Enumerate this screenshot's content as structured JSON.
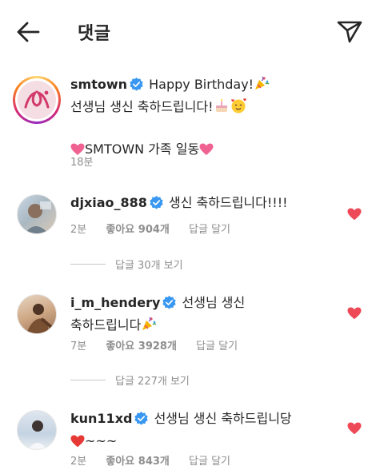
{
  "header": {
    "title": "댓글"
  },
  "caption": {
    "username": "smtown",
    "text_line1": "Happy Birthday!",
    "text_line2": "선생님 생신 축하드립니다!",
    "text_line3": "SMTOWN 가족 일동",
    "time": "18분"
  },
  "comments": [
    {
      "username": "djxiao_888",
      "text": "생신 축하드립니다!!!!",
      "time": "2분",
      "likes": "좋아요 904개",
      "reply": "답글 달기",
      "view_replies": "답글 30개 보기",
      "liked": true
    },
    {
      "username": "i_m_hendery",
      "text_line1": "선생님 생신",
      "text_line2": "축하드립니다",
      "time": "7분",
      "likes": "좋아요 3928개",
      "reply": "답글 달기",
      "view_replies": "답글 227개 보기",
      "liked": true
    },
    {
      "username": "kun11xd",
      "text_line1": "선생님 생신 축하드립니당",
      "text_line2": "~~~",
      "time": "2분",
      "likes": "좋아요 843개",
      "reply": "답글 달기",
      "liked": true
    }
  ],
  "colors": {
    "heart": "#ed4956",
    "verified": "#3897f0",
    "meta": "#8e8e8e",
    "text": "#262626"
  },
  "icons": {
    "back": "arrow-left-icon",
    "share": "paper-plane-icon",
    "verified": "verified-badge-icon",
    "heart": "heart-filled-icon"
  }
}
